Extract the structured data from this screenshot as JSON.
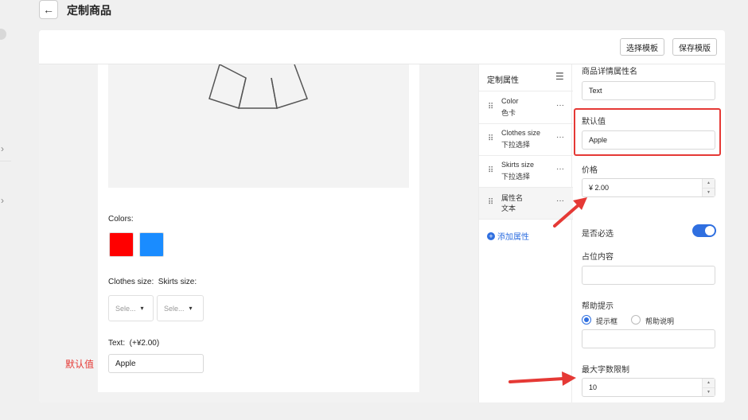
{
  "header": {
    "title": "定制商品"
  },
  "toolbar": {
    "select_template": "选择模板",
    "save_template": "保存模版"
  },
  "preview": {
    "colors_label": "Colors:",
    "swatches": [
      {
        "color": "#ff0000"
      },
      {
        "color": "#1a8cff"
      }
    ],
    "size_label": "Clothes size:  Skirts size:",
    "selects": [
      {
        "placeholder": "Sele..."
      },
      {
        "placeholder": "Sele..."
      }
    ],
    "text_label": "Text:  (+¥2.00)",
    "text_value": "Apple"
  },
  "annotation": {
    "default_value_note": "默认值"
  },
  "attributes": {
    "title": "定制属性",
    "items": [
      {
        "name": "Color",
        "type": "色卡"
      },
      {
        "name": "Clothes size",
        "type": "下拉选择"
      },
      {
        "name": "Skirts size",
        "type": "下拉选择"
      },
      {
        "name": "属性名",
        "type": "文本"
      }
    ],
    "more_label": "···",
    "add_label": "添加属性"
  },
  "settings": {
    "detail_name_label": "商品详情属性名",
    "detail_name_value": "Text",
    "default_label": "默认值",
    "default_value": "Apple",
    "price_label": "价格",
    "price_value": "¥ 2.00",
    "required_label": "是否必选",
    "required_on": true,
    "placeholder_label": "占位内容",
    "placeholder_value": "",
    "help_label": "帮助提示",
    "help_options": [
      "提示框",
      "帮助说明"
    ],
    "help_selected": "提示框",
    "help_value": "",
    "max_len_label": "最大字数限制",
    "max_len_value": "10"
  },
  "colors": {
    "accent": "#2f6fe0",
    "highlight": "#e53935"
  }
}
